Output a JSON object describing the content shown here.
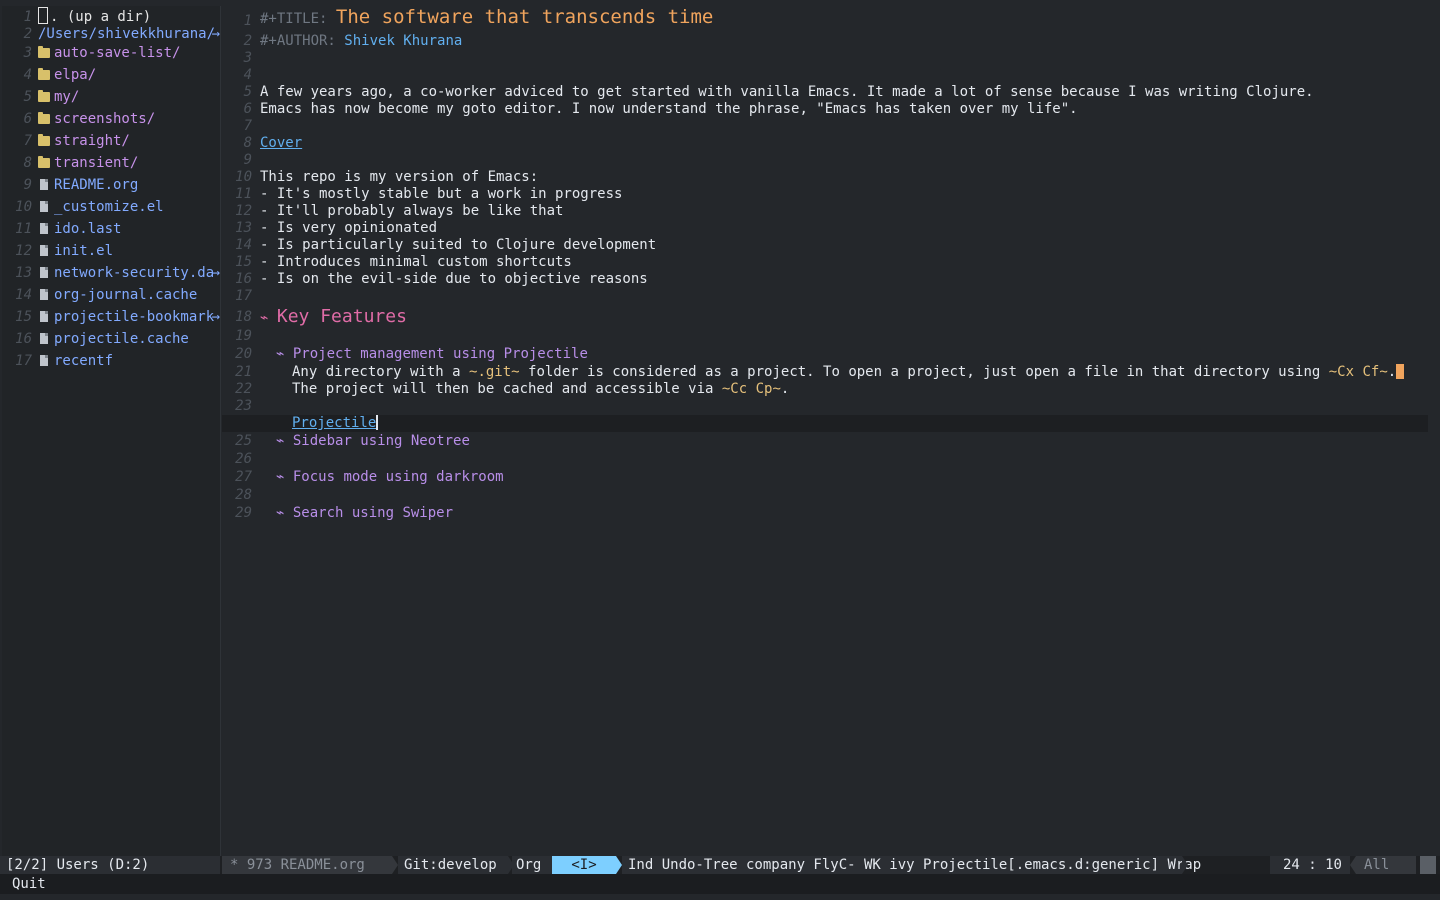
{
  "sidebar": {
    "rows": [
      {
        "num": "1",
        "label": ". (up a dir)",
        "kind": "updir"
      },
      {
        "num": "2",
        "label": "/Users/shivekkhurana/",
        "kind": "path"
      },
      {
        "num": "3",
        "label": "auto-save-list/",
        "kind": "dir"
      },
      {
        "num": "4",
        "label": "elpa/",
        "kind": "dir"
      },
      {
        "num": "5",
        "label": "my/",
        "kind": "dir"
      },
      {
        "num": "6",
        "label": "screenshots/",
        "kind": "dir"
      },
      {
        "num": "7",
        "label": "straight/",
        "kind": "dir"
      },
      {
        "num": "8",
        "label": "transient/",
        "kind": "dir"
      },
      {
        "num": "9",
        "label": "README.org",
        "kind": "file"
      },
      {
        "num": "10",
        "label": "_customize.el",
        "kind": "file"
      },
      {
        "num": "11",
        "label": "ido.last",
        "kind": "file"
      },
      {
        "num": "12",
        "label": "init.el",
        "kind": "file"
      },
      {
        "num": "13",
        "label": "network-security.da",
        "kind": "file",
        "truncated": true
      },
      {
        "num": "14",
        "label": "org-journal.cache",
        "kind": "file"
      },
      {
        "num": "15",
        "label": "projectile-bookmark",
        "kind": "file",
        "truncated": true
      },
      {
        "num": "16",
        "label": "projectile.cache",
        "kind": "file"
      },
      {
        "num": "17",
        "label": "recentf",
        "kind": "file"
      }
    ],
    "truncation_glyph": "→"
  },
  "editor": {
    "line_numbers": [
      "1",
      "2",
      "3",
      "4",
      "5",
      "6",
      "7",
      "8",
      "9",
      "10",
      "11",
      "12",
      "13",
      "14",
      "15",
      "16",
      "17",
      "18",
      "19",
      "20",
      "21",
      "22",
      "23",
      "24",
      "25",
      "26",
      "27",
      "28",
      "29"
    ],
    "title_key": "#+TITLE:",
    "title_value": "The software that transcends time",
    "author_key": "#+AUTHOR:",
    "author_value": "Shivek Khurana",
    "para1_line1": "A few years ago, a co-worker adviced to get started with vanilla Emacs. It made a lot of sense because I was writing Clojure.",
    "para1_line2": "Emacs has now become my goto editor. I now understand the phrase, \"Emacs has taken over my life\".",
    "cover_link": "Cover",
    "repo_intro": "This repo is my version of Emacs:",
    "bullets": [
      "- It's mostly stable but a work in progress",
      "- It'll probably always be like that",
      "- Is very opinionated",
      "- Is particularly suited to Clojure development",
      "- Introduces minimal custom shortcuts",
      "- Is on the evil-side due to objective reasons"
    ],
    "heading_star": "⌁",
    "key_features": "Key Features",
    "sub1": "Project management using Projectile",
    "sub1_l1_a": "Any directory with a ",
    "sub1_l1_code1": "~.git~",
    "sub1_l1_b": " folder is considered as a project. To open a project, just open a file in that directory using ",
    "sub1_l1_code2": "~Cx Cf~",
    "sub1_l1_c": ".",
    "sub1_l2_a": "The project will then be cached and accessible via ",
    "sub1_l2_code": "~Cc Cp~",
    "sub1_l2_b": ".",
    "projectile_link": "Projectile",
    "sub2": "Sidebar using Neotree",
    "sub3": "Focus mode using darkroom",
    "sub4": "Search using Swiper"
  },
  "modeline": {
    "left": "[2/2] Users (D:2)",
    "status": "* 973  README.org",
    "git": "Git:develop",
    "mode": "Org",
    "evil_state": "<I>",
    "minor_modes": "Ind Undo-Tree company FlyC- WK ivy Projectile[.emacs.d:generic] Wrap",
    "position": "24 : 10",
    "scroll": "All"
  },
  "minibuffer": {
    "text": "Quit"
  }
}
